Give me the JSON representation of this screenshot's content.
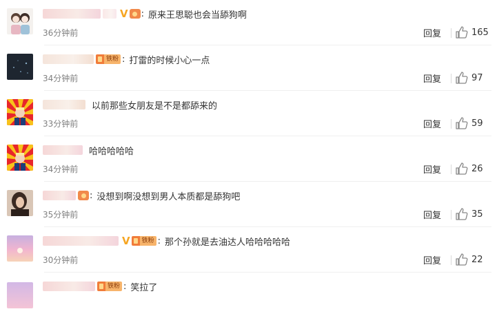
{
  "comments": [
    {
      "name_style": "pink",
      "vip": "V",
      "badge": "medal",
      "fan_label": "",
      "text": "原来王思聪也会当舔狗啊",
      "time": "36分钟前",
      "reply": "回复",
      "likes": "165",
      "avatar": "anime-couple"
    },
    {
      "name_style": "peach",
      "vip": "",
      "badge": "fan",
      "fan_label": "铁粉",
      "text": "打雷的时候小心一点",
      "time": "34分钟前",
      "reply": "回复",
      "likes": "97",
      "avatar": "dark-night"
    },
    {
      "name_style": "peach",
      "vip": "",
      "badge": "none",
      "fan_label": "",
      "text": "以前那些女朋友是不是都舔来的",
      "time": "33分钟前",
      "reply": "回复",
      "likes": "59",
      "avatar": "sunburst-figure"
    },
    {
      "name_style": "pink",
      "vip": "",
      "badge": "none",
      "fan_label": "",
      "text": "哈哈哈哈哈",
      "time": "34分钟前",
      "reply": "回复",
      "likes": "26",
      "avatar": "sunburst-figure"
    },
    {
      "name_style": "pink",
      "vip": "",
      "badge": "medal",
      "fan_label": "",
      "text": "没想到啊没想到男人本质都是舔狗吧",
      "time": "35分钟前",
      "reply": "回复",
      "likes": "35",
      "avatar": "woman-portrait"
    },
    {
      "name_style": "pink",
      "vip": "V",
      "badge": "fan",
      "fan_label": "铁粉",
      "text": "那个孙就是去油达人哈哈哈哈哈",
      "time": "30分钟前",
      "reply": "回复",
      "likes": "22",
      "avatar": "pink-sunset"
    },
    {
      "name_style": "pink",
      "vip": "",
      "badge": "fan",
      "fan_label": "铁粉",
      "text": "笑拉了",
      "time": "",
      "reply": "",
      "likes": "",
      "avatar": "pink-sunset"
    }
  ]
}
